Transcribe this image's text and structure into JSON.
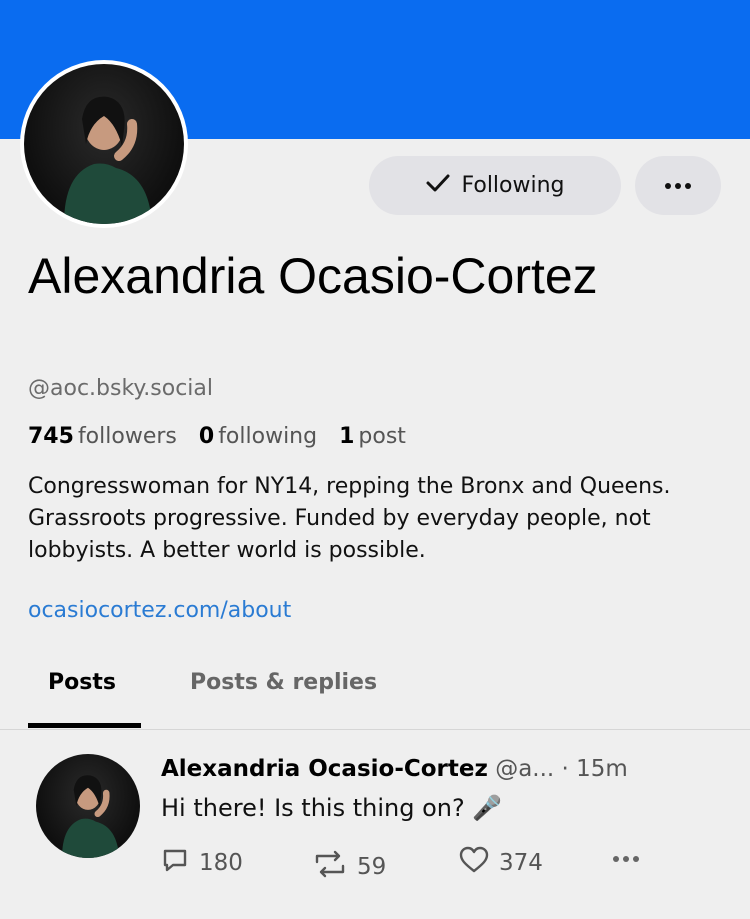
{
  "profile": {
    "name": "Alexandria Ocasio-Cortez",
    "handle": "@aoc.bsky.social",
    "followers_count": "745",
    "followers_label": "followers",
    "following_count": "0",
    "following_label": "following",
    "posts_count": "1",
    "posts_label": "post",
    "bio": "Congresswoman for NY14, repping the Bronx and Queens. Grassroots progressive. Funded by everyday people, not lobbyists. A better world is possible.",
    "link": "ocasiocortez.com/about"
  },
  "actions": {
    "following_label": "Following"
  },
  "tabs": [
    {
      "label": "Posts",
      "active": true
    },
    {
      "label": "Posts & replies",
      "active": false
    }
  ],
  "post": {
    "author": "Alexandria Ocasio-Cortez",
    "handle": "@a...",
    "separator": "·",
    "time": "15m",
    "text": "Hi there! Is this thing on? 🎤",
    "replies": "180",
    "reposts": "59",
    "likes": "374"
  },
  "colors": {
    "banner": "#0a6cf0",
    "link": "#2a7bd3",
    "background": "#efefef"
  },
  "icons": [
    "checkmark-icon",
    "more-dots-icon",
    "reply-icon",
    "repost-icon",
    "heart-icon",
    "microphone-icon"
  ]
}
